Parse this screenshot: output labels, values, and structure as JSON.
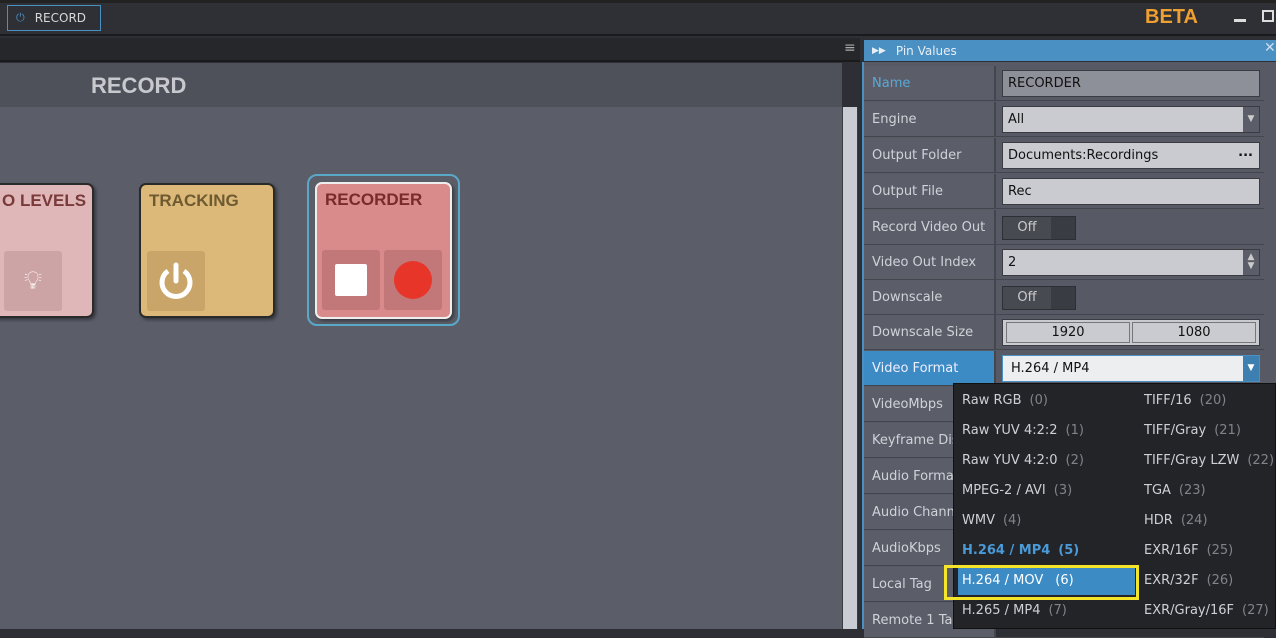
{
  "topbar": {
    "record_tab": "RECORD",
    "beta": "BETA"
  },
  "left_panel": {
    "title": "RECORD",
    "tiles": [
      {
        "title": "O LEVELS",
        "color": "#e0b7b8"
      },
      {
        "title": "TRACKING",
        "color": "#dcb978"
      },
      {
        "title": "RECORDER",
        "color": "#d98a8a"
      }
    ]
  },
  "pin_values": {
    "title": "Pin Values",
    "rows": [
      {
        "label": "Name",
        "value": "RECORDER"
      },
      {
        "label": "Engine",
        "value": "All"
      },
      {
        "label": "Output Folder",
        "value": "Documents:Recordings",
        "button": "..."
      },
      {
        "label": "Output File",
        "value": "Rec"
      },
      {
        "label": "Record Video Out",
        "value": "Off"
      },
      {
        "label": "Video Out Index",
        "value": "2"
      },
      {
        "label": "Downscale",
        "value": "Off"
      },
      {
        "label": "Downscale Size",
        "width": "1920",
        "height": "1080"
      },
      {
        "label": "Video Format",
        "value": "H.264 / MP4"
      },
      {
        "label": "VideoMbps"
      },
      {
        "label": "Keyframe Dis"
      },
      {
        "label": "Audio Forma"
      },
      {
        "label": "Audio Chann"
      },
      {
        "label": "AudioKbps"
      },
      {
        "label": "Local Tag"
      },
      {
        "label": "Remote 1 Ta"
      }
    ]
  },
  "video_format_options": {
    "col1": [
      {
        "label": "Raw RGB",
        "n": "(0)"
      },
      {
        "label": "Raw YUV 4:2:2",
        "n": "(1)"
      },
      {
        "label": "Raw YUV 4:2:0",
        "n": "(2)"
      },
      {
        "label": "MPEG-2 / AVI",
        "n": "(3)"
      },
      {
        "label": "WMV",
        "n": "(4)"
      },
      {
        "label": "H.264 / MP4",
        "n": "(5)",
        "selected": true
      },
      {
        "label": "H.264 / MOV",
        "n": "(6)",
        "hovered": true
      },
      {
        "label": "H.265 / MP4",
        "n": "(7)"
      }
    ],
    "col2": [
      {
        "label": "TIFF/16",
        "n": "(20)"
      },
      {
        "label": "TIFF/Gray",
        "n": "(21)"
      },
      {
        "label": "TIFF/Gray LZW",
        "n": "(22)"
      },
      {
        "label": "TGA",
        "n": "(23)"
      },
      {
        "label": "HDR",
        "n": "(24)"
      },
      {
        "label": "EXR/16F",
        "n": "(25)"
      },
      {
        "label": "EXR/32F",
        "n": "(26)"
      },
      {
        "label": "EXR/Gray/16F",
        "n": "(27)"
      }
    ]
  },
  "colors": {
    "accent": "#4a90c2",
    "beta": "#f0a030",
    "highlight": "#f5e52a",
    "record_dot": "#e8352a"
  }
}
